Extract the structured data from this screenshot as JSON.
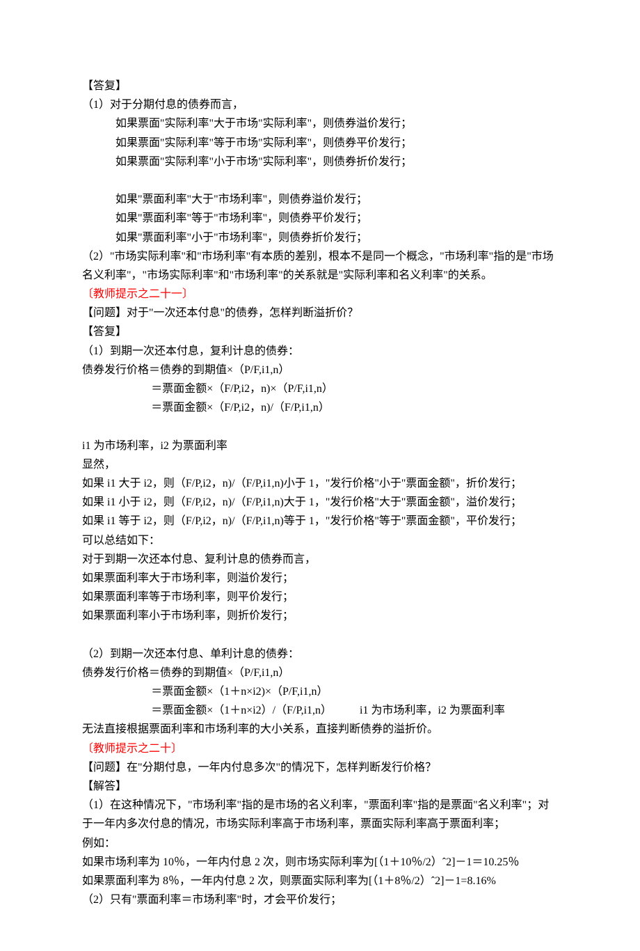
{
  "lines": [
    {
      "cls": "line",
      "text": "【答复】"
    },
    {
      "cls": "line",
      "text": "（1）对于分期付息的债券而言，"
    },
    {
      "cls": "line",
      "text": "　　　如果票面\"实际利率\"大于市场\"实际利率\"，则债券溢价发行；"
    },
    {
      "cls": "line",
      "text": "　　　如果票面\"实际利率\"等于市场\"实际利率\"，则债券平价发行；"
    },
    {
      "cls": "line",
      "text": "　　　如果票面\"实际利率\"小于市场\"实际利率\"，则债券折价发行；"
    },
    {
      "cls": "blank",
      "text": ""
    },
    {
      "cls": "line",
      "text": "　　　如果\"票面利率\"大于\"市场利率\"，则债券溢价发行；"
    },
    {
      "cls": "line",
      "text": "　　　如果\"票面利率\"等于\"市场利率\"，则债券平价发行；"
    },
    {
      "cls": "line",
      "text": "　　　如果\"票面利率\"小于\"市场利率\"，则债券折价发行；"
    },
    {
      "cls": "line",
      "text": "（2）\"市场实际利率\"和\"市场利率\"有本质的差别，根本不是同一个概念，\"市场利率\"指的是\"市场名义利率\"，\"市场实际利率\"和\"市场利率\"的关系就是\"实际利率和名义利率\"的关系。"
    },
    {
      "cls": "line header",
      "text": "〔教师提示之二十一〕"
    },
    {
      "cls": "line",
      "text": "【问题】对于\"一次还本付息\"的债券，怎样判断溢折价？"
    },
    {
      "cls": "line",
      "text": "【答复】"
    },
    {
      "cls": "line",
      "text": "（1）到期一次还本付息，复利计息的债券："
    },
    {
      "cls": "line",
      "text": "债券发行价格＝债券的到期值×（P/F,i1,n）"
    },
    {
      "cls": "line indent1",
      "text": "＝票面金额×（F/P,i2，n)×（P/F,i1,n）"
    },
    {
      "cls": "line indent1",
      "text": "＝票面金额×（F/P,i2，n)/（F/P,i1,n）"
    },
    {
      "cls": "blank",
      "text": ""
    },
    {
      "cls": "line",
      "text": "i1 为市场利率，i2 为票面利率"
    },
    {
      "cls": "line",
      "text": "显然，"
    },
    {
      "cls": "line",
      "text": "如果 i1 大于 i2，则（F/P,i2，n)/（F/P,i1,n)小于 1，\"发行价格\"小于\"票面金额\"，折价发行；"
    },
    {
      "cls": "line",
      "text": "如果 i1 小于 i2，则（F/P,i2，n)/（F/P,i1,n)大于 1，\"发行价格\"大于\"票面金额\"，溢价发行；"
    },
    {
      "cls": "line",
      "text": "如果 i1 等于 i2，则（F/P,i2，n)/（F/P,i1,n)等于 1，\"发行价格\"等于\"票面金额\"，平价发行；"
    },
    {
      "cls": "line",
      "text": "可以总结如下："
    },
    {
      "cls": "line",
      "text": "对于到期一次还本付息、复利计息的债券而言，"
    },
    {
      "cls": "line",
      "text": "如果票面利率大于市场利率，则溢价发行；"
    },
    {
      "cls": "line",
      "text": "如果票面利率等于市场利率，则平价发行；"
    },
    {
      "cls": "line",
      "text": "如果票面利率小于市场利率，则折价发行；"
    },
    {
      "cls": "blank",
      "text": ""
    },
    {
      "cls": "line",
      "text": "（2）到期一次还本付息、单利计息的债券："
    },
    {
      "cls": "line",
      "text": "债券发行价格＝债券的到期值×（P/F,i1,n）"
    },
    {
      "cls": "line indent1",
      "text": "＝票面金额×（1＋n×i2)×（P/F,i1,n）"
    },
    {
      "cls": "line indent1",
      "text": "＝票面金额×（1＋n×i2）/（F/P,i1,n）　　　i1 为市场利率，i2 为票面利率"
    },
    {
      "cls": "line",
      "text": "无法直接根据票面利率和市场利率的大小关系，直接判断债券的溢折价。"
    },
    {
      "cls": "line header",
      "text": "〔教师提示之二十〕"
    },
    {
      "cls": "line",
      "text": "【问题】在\"分期付息，一年内付息多次\"的情况下，怎样判断发行价格？"
    },
    {
      "cls": "line",
      "text": "【解答】"
    },
    {
      "cls": "line",
      "text": "（1）在这种情况下，\"市场利率\"指的是市场的名义利率，\"票面利率\"指的是票面\"名义利率\"；对于一年内多次付息的情况，市场实际利率高于市场利率，票面实际利率高于票面利率；"
    },
    {
      "cls": "line",
      "text": "例如："
    },
    {
      "cls": "line",
      "text": "如果市场利率为 10％，一年内付息 2 次，则市场实际利率为[（1＋10％/2）ˆ2]－1＝10.25％"
    },
    {
      "cls": "line",
      "text": "如果票面利率为 8％，一年内付息 2 次，则票面实际利率为[（1＋8％/2）ˆ2]－1=8.16%"
    },
    {
      "cls": "line",
      "text": "（2）只有\"票面利率＝市场利率\"时，才会平价发行；"
    }
  ]
}
